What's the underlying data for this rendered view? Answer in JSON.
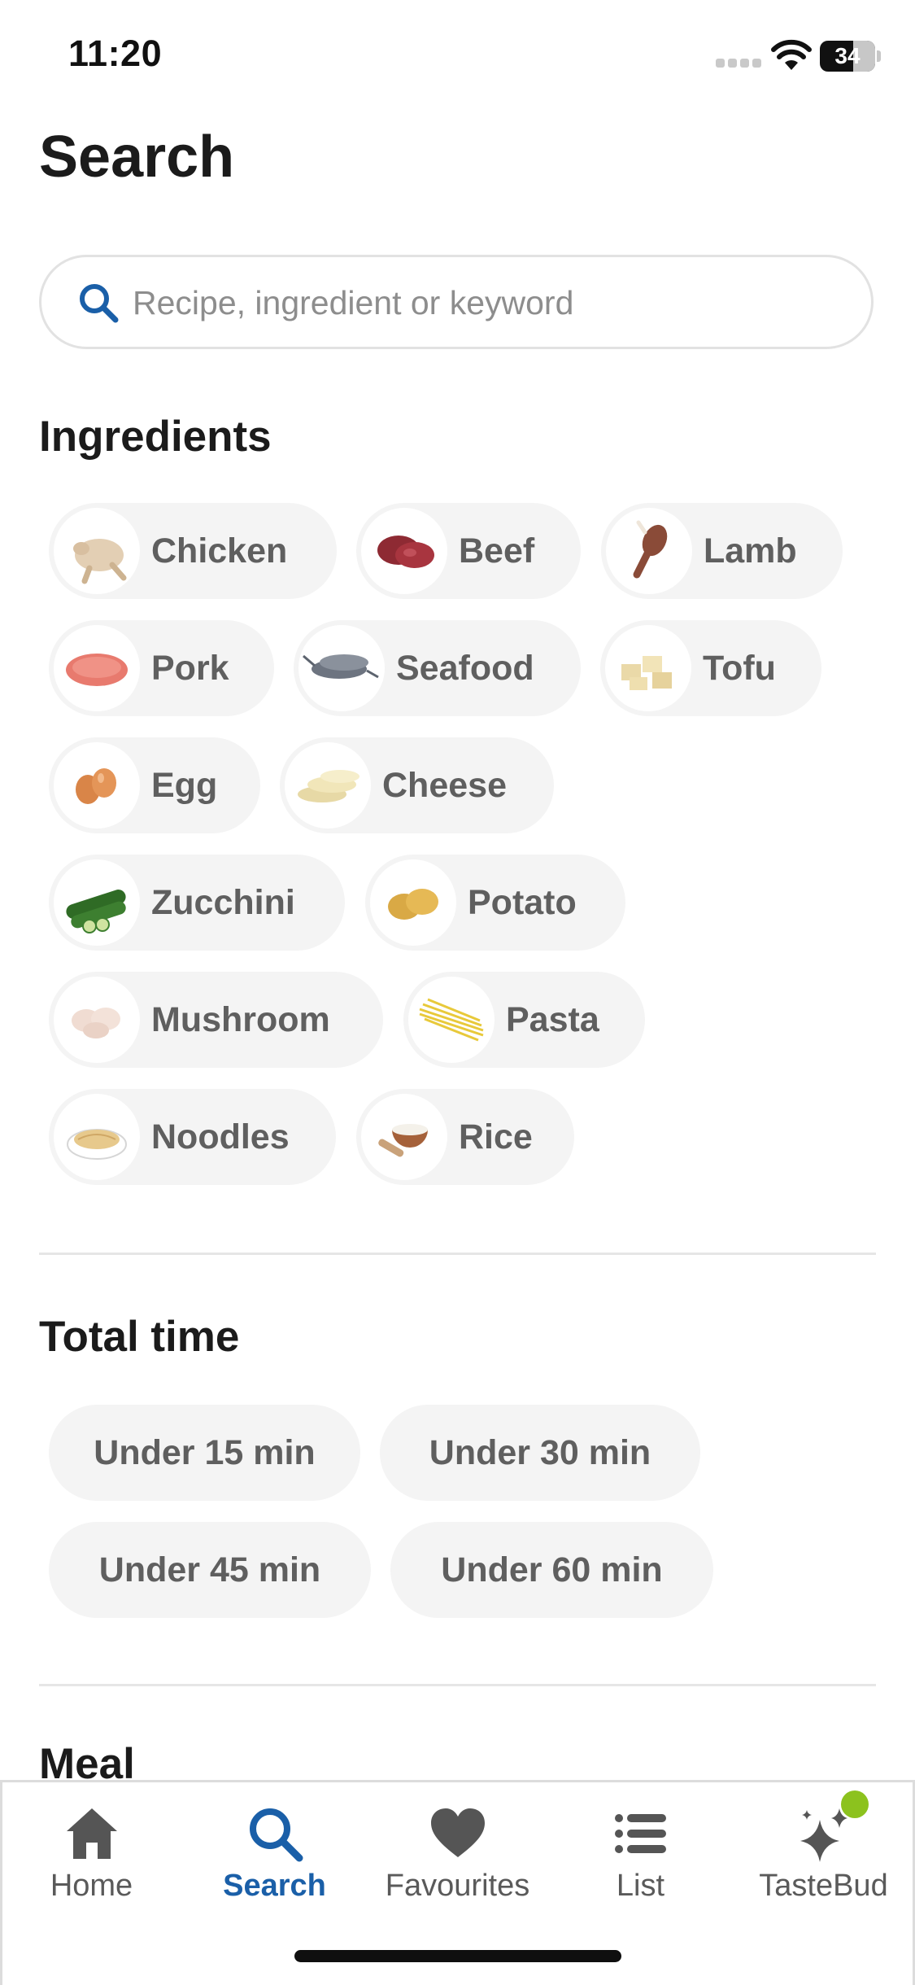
{
  "status_bar": {
    "time": "11:20",
    "battery": "34"
  },
  "page_title": "Search",
  "search": {
    "placeholder": "Recipe, ingredient or keyword",
    "value": ""
  },
  "sections": {
    "ingredients_title": "Ingredients",
    "total_time_title": "Total time",
    "meal_title": "Meal"
  },
  "ingredients": [
    {
      "label": "Chicken",
      "icon": "chicken-icon"
    },
    {
      "label": "Beef",
      "icon": "beef-icon"
    },
    {
      "label": "Lamb",
      "icon": "lamb-icon"
    },
    {
      "label": "Pork",
      "icon": "pork-icon"
    },
    {
      "label": "Seafood",
      "icon": "seafood-icon"
    },
    {
      "label": "Tofu",
      "icon": "tofu-icon"
    },
    {
      "label": "Egg",
      "icon": "egg-icon"
    },
    {
      "label": "Cheese",
      "icon": "cheese-icon"
    },
    {
      "label": "Zucchini",
      "icon": "zucchini-icon"
    },
    {
      "label": "Potato",
      "icon": "potato-icon"
    },
    {
      "label": "Mushroom",
      "icon": "mushroom-icon"
    },
    {
      "label": "Pasta",
      "icon": "pasta-icon"
    },
    {
      "label": "Noodles",
      "icon": "noodles-icon"
    },
    {
      "label": "Rice",
      "icon": "rice-icon"
    }
  ],
  "total_time": [
    {
      "label": "Under 15 min"
    },
    {
      "label": "Under 30 min"
    },
    {
      "label": "Under 45 min"
    },
    {
      "label": "Under 60 min"
    }
  ],
  "tab_bar": {
    "items": [
      {
        "label": "Home",
        "icon": "home-icon",
        "active": false
      },
      {
        "label": "Search",
        "icon": "search-icon",
        "active": true
      },
      {
        "label": "Favourites",
        "icon": "heart-icon",
        "active": false
      },
      {
        "label": "List",
        "icon": "list-icon",
        "active": false
      },
      {
        "label": "TasteBud",
        "icon": "sparkle-icon",
        "active": false
      }
    ]
  },
  "colors": {
    "accent": "#1a5fa8",
    "chip_background": "#f4f4f4",
    "chip_text": "#5f5f5f",
    "notification_dot": "#8cc21e"
  }
}
